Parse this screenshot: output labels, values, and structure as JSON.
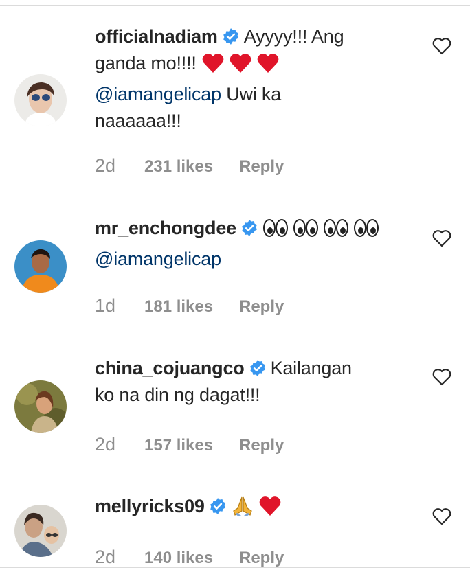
{
  "comments": [
    {
      "username": "officialnadiam",
      "text_line1": "Ayyyy!!! Ang",
      "text_line2": "ganda mo!!!!",
      "mention": "@iamangelicap",
      "text_after_mention": "Uwi ka",
      "text_line4": "naaaaaa!!!",
      "time": "2d",
      "likes": "231 likes",
      "reply": "Reply"
    },
    {
      "username": "mr_enchongdee",
      "mention": "@iamangelicap",
      "time": "1d",
      "likes": "181 likes",
      "reply": "Reply"
    },
    {
      "username": "china_cojuangco",
      "text_line1": "Kailangan",
      "text_line2": "ko na din ng dagat!!!",
      "time": "2d",
      "likes": "157 likes",
      "reply": "Reply"
    },
    {
      "username": "mellyricks09",
      "time": "2d",
      "likes": "140 likes",
      "reply": "Reply"
    }
  ],
  "colors": {
    "verified_badge": "#3897f0",
    "mention": "#003569",
    "meta_text": "#8e8e8e",
    "heart_emoji": "#e0152a"
  },
  "icons": [
    "verified-badge-icon",
    "heart-outline-icon",
    "red-heart-emoji",
    "eyes-emoji",
    "folded-hands-emoji"
  ]
}
